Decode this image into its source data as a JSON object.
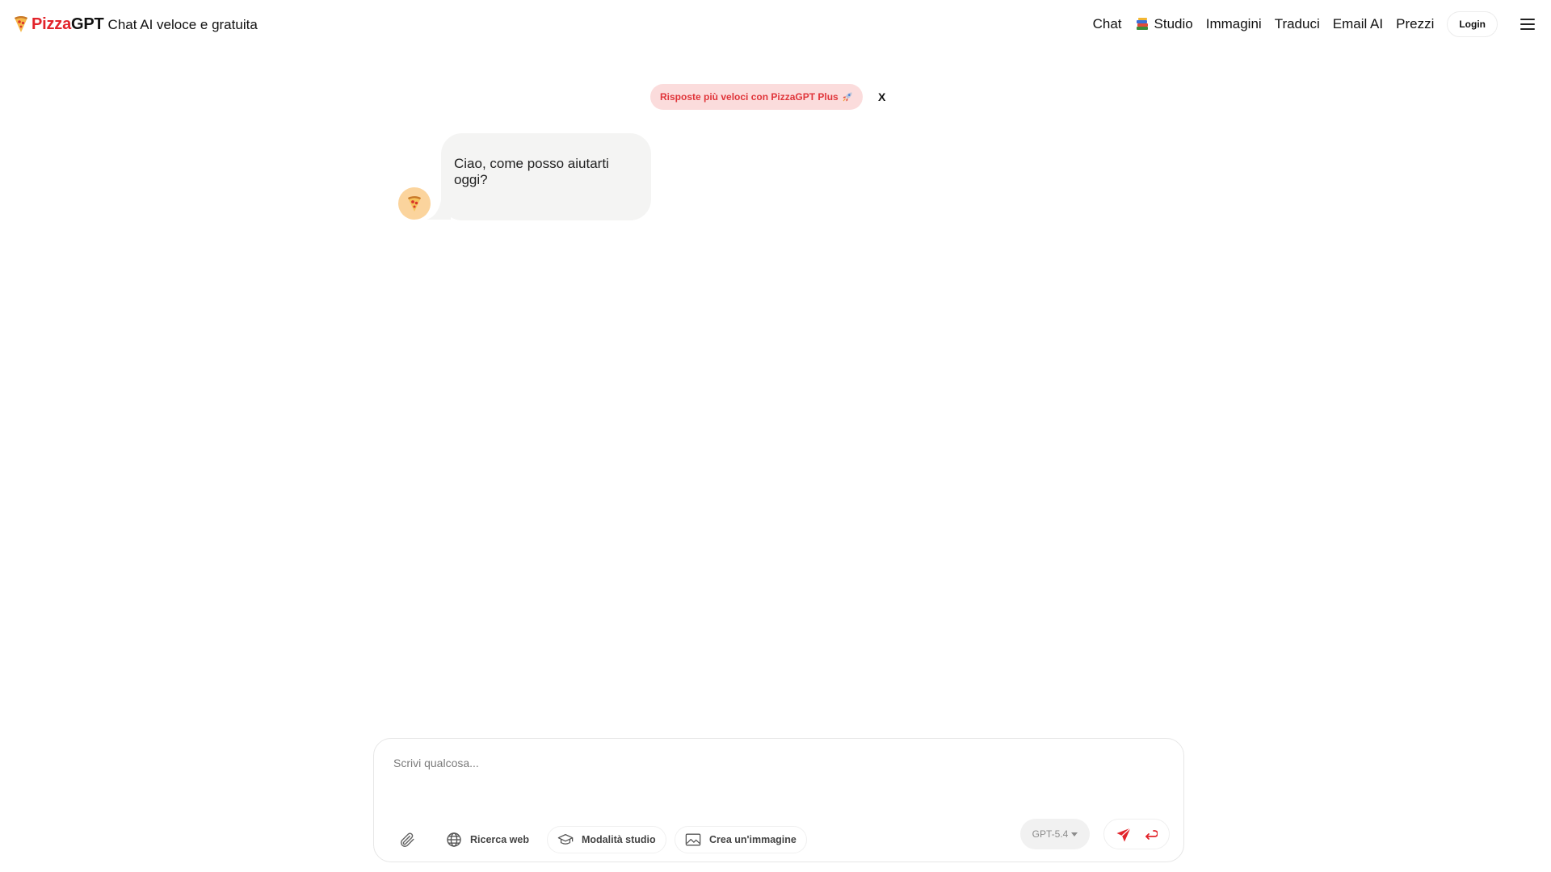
{
  "header": {
    "brand_pizza": "Pizza",
    "brand_gpt": "GPT",
    "tagline": "Chat AI veloce e gratuita",
    "nav": {
      "chat": "Chat",
      "studio": "Studio",
      "images": "Immagini",
      "translate": "Traduci",
      "email": "Email AI",
      "pricing": "Prezzi"
    },
    "login_label": "Login"
  },
  "promo": {
    "text": "Risposte più veloci con PizzaGPT Plus",
    "close_label": "X"
  },
  "chat": {
    "messages": [
      {
        "role": "assistant",
        "text": "Ciao, come posso aiutarti oggi?"
      }
    ]
  },
  "composer": {
    "placeholder": "Scrivi qualcosa...",
    "tools": {
      "web_search": "Ricerca web",
      "study_mode": "Modalità studio",
      "create_image": "Crea un'immagine"
    },
    "model": "GPT-5.4"
  },
  "colors": {
    "brand_red": "#e2242b",
    "promo_bg": "#fbdcdc",
    "promo_text": "#e0353a",
    "bubble_bg": "#f4f4f3",
    "avatar_bg": "#fbd49d"
  },
  "icons": {
    "logo": "pizza-slice-icon",
    "studio": "books-icon",
    "promo": "rocket-icon",
    "menu": "hamburger-menu-icon",
    "attach": "paperclip-icon",
    "web": "globe-icon",
    "study": "graduation-cap-icon",
    "image": "image-icon",
    "send": "paper-plane-icon",
    "return": "return-arrow-icon"
  }
}
